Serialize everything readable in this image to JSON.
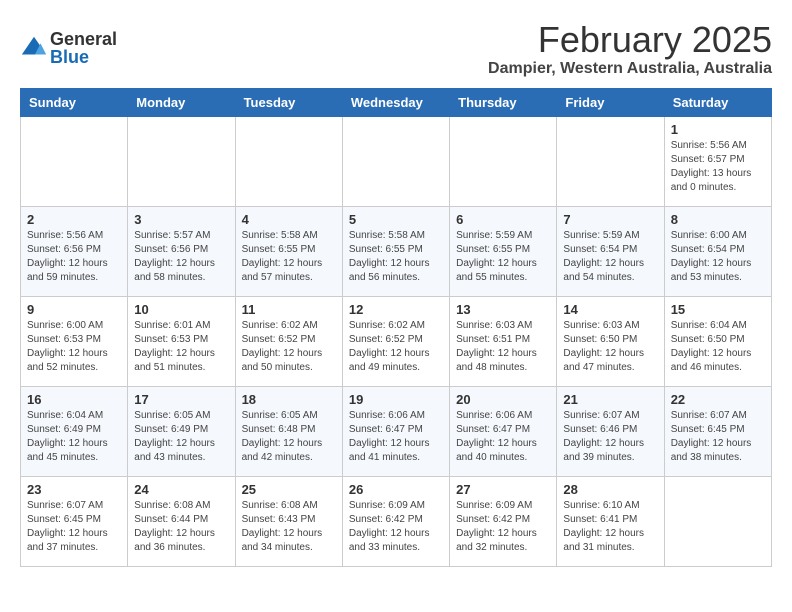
{
  "header": {
    "logo_general": "General",
    "logo_blue": "Blue",
    "month_title": "February 2025",
    "location": "Dampier, Western Australia, Australia"
  },
  "weekdays": [
    "Sunday",
    "Monday",
    "Tuesday",
    "Wednesday",
    "Thursday",
    "Friday",
    "Saturday"
  ],
  "weeks": [
    [
      {
        "day": "",
        "info": ""
      },
      {
        "day": "",
        "info": ""
      },
      {
        "day": "",
        "info": ""
      },
      {
        "day": "",
        "info": ""
      },
      {
        "day": "",
        "info": ""
      },
      {
        "day": "",
        "info": ""
      },
      {
        "day": "1",
        "info": "Sunrise: 5:56 AM\nSunset: 6:57 PM\nDaylight: 13 hours\nand 0 minutes."
      }
    ],
    [
      {
        "day": "2",
        "info": "Sunrise: 5:56 AM\nSunset: 6:56 PM\nDaylight: 12 hours\nand 59 minutes."
      },
      {
        "day": "3",
        "info": "Sunrise: 5:57 AM\nSunset: 6:56 PM\nDaylight: 12 hours\nand 58 minutes."
      },
      {
        "day": "4",
        "info": "Sunrise: 5:58 AM\nSunset: 6:55 PM\nDaylight: 12 hours\nand 57 minutes."
      },
      {
        "day": "5",
        "info": "Sunrise: 5:58 AM\nSunset: 6:55 PM\nDaylight: 12 hours\nand 56 minutes."
      },
      {
        "day": "6",
        "info": "Sunrise: 5:59 AM\nSunset: 6:55 PM\nDaylight: 12 hours\nand 55 minutes."
      },
      {
        "day": "7",
        "info": "Sunrise: 5:59 AM\nSunset: 6:54 PM\nDaylight: 12 hours\nand 54 minutes."
      },
      {
        "day": "8",
        "info": "Sunrise: 6:00 AM\nSunset: 6:54 PM\nDaylight: 12 hours\nand 53 minutes."
      }
    ],
    [
      {
        "day": "9",
        "info": "Sunrise: 6:00 AM\nSunset: 6:53 PM\nDaylight: 12 hours\nand 52 minutes."
      },
      {
        "day": "10",
        "info": "Sunrise: 6:01 AM\nSunset: 6:53 PM\nDaylight: 12 hours\nand 51 minutes."
      },
      {
        "day": "11",
        "info": "Sunrise: 6:02 AM\nSunset: 6:52 PM\nDaylight: 12 hours\nand 50 minutes."
      },
      {
        "day": "12",
        "info": "Sunrise: 6:02 AM\nSunset: 6:52 PM\nDaylight: 12 hours\nand 49 minutes."
      },
      {
        "day": "13",
        "info": "Sunrise: 6:03 AM\nSunset: 6:51 PM\nDaylight: 12 hours\nand 48 minutes."
      },
      {
        "day": "14",
        "info": "Sunrise: 6:03 AM\nSunset: 6:50 PM\nDaylight: 12 hours\nand 47 minutes."
      },
      {
        "day": "15",
        "info": "Sunrise: 6:04 AM\nSunset: 6:50 PM\nDaylight: 12 hours\nand 46 minutes."
      }
    ],
    [
      {
        "day": "16",
        "info": "Sunrise: 6:04 AM\nSunset: 6:49 PM\nDaylight: 12 hours\nand 45 minutes."
      },
      {
        "day": "17",
        "info": "Sunrise: 6:05 AM\nSunset: 6:49 PM\nDaylight: 12 hours\nand 43 minutes."
      },
      {
        "day": "18",
        "info": "Sunrise: 6:05 AM\nSunset: 6:48 PM\nDaylight: 12 hours\nand 42 minutes."
      },
      {
        "day": "19",
        "info": "Sunrise: 6:06 AM\nSunset: 6:47 PM\nDaylight: 12 hours\nand 41 minutes."
      },
      {
        "day": "20",
        "info": "Sunrise: 6:06 AM\nSunset: 6:47 PM\nDaylight: 12 hours\nand 40 minutes."
      },
      {
        "day": "21",
        "info": "Sunrise: 6:07 AM\nSunset: 6:46 PM\nDaylight: 12 hours\nand 39 minutes."
      },
      {
        "day": "22",
        "info": "Sunrise: 6:07 AM\nSunset: 6:45 PM\nDaylight: 12 hours\nand 38 minutes."
      }
    ],
    [
      {
        "day": "23",
        "info": "Sunrise: 6:07 AM\nSunset: 6:45 PM\nDaylight: 12 hours\nand 37 minutes."
      },
      {
        "day": "24",
        "info": "Sunrise: 6:08 AM\nSunset: 6:44 PM\nDaylight: 12 hours\nand 36 minutes."
      },
      {
        "day": "25",
        "info": "Sunrise: 6:08 AM\nSunset: 6:43 PM\nDaylight: 12 hours\nand 34 minutes."
      },
      {
        "day": "26",
        "info": "Sunrise: 6:09 AM\nSunset: 6:42 PM\nDaylight: 12 hours\nand 33 minutes."
      },
      {
        "day": "27",
        "info": "Sunrise: 6:09 AM\nSunset: 6:42 PM\nDaylight: 12 hours\nand 32 minutes."
      },
      {
        "day": "28",
        "info": "Sunrise: 6:10 AM\nSunset: 6:41 PM\nDaylight: 12 hours\nand 31 minutes."
      },
      {
        "day": "",
        "info": ""
      }
    ]
  ]
}
